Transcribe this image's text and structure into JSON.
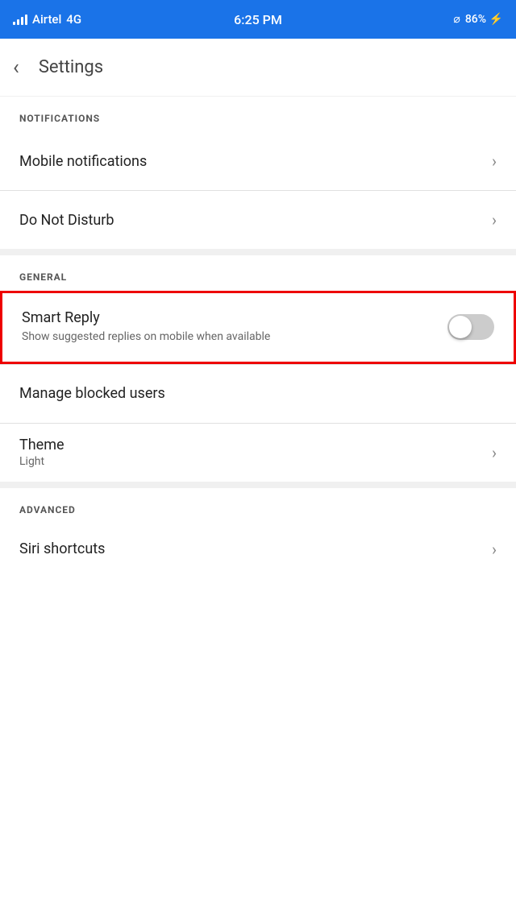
{
  "statusBar": {
    "carrier": "Airtel",
    "network": "4G",
    "time": "6:25 PM",
    "battery": "86%",
    "headphones": true
  },
  "header": {
    "back_label": "‹",
    "title": "Settings"
  },
  "sections": {
    "notifications": {
      "label": "NOTIFICATIONS",
      "items": [
        {
          "id": "mobile-notifications",
          "text": "Mobile notifications",
          "hasChevron": true
        },
        {
          "id": "do-not-disturb",
          "text": "Do Not Disturb",
          "hasChevron": true
        }
      ]
    },
    "general": {
      "label": "GENERAL",
      "smartReply": {
        "title": "Smart Reply",
        "subtitle": "Show suggested replies on mobile when available",
        "toggleOn": false
      },
      "items": [
        {
          "id": "manage-blocked-users",
          "text": "Manage blocked users",
          "hasChevron": false
        },
        {
          "id": "theme",
          "text": "Theme",
          "subtext": "Light",
          "hasChevron": true
        }
      ]
    },
    "advanced": {
      "label": "ADVANCED",
      "items": [
        {
          "id": "siri-shortcuts",
          "text": "Siri shortcuts",
          "hasChevron": true
        }
      ]
    }
  },
  "icons": {
    "chevron": "›",
    "back": "‹"
  }
}
